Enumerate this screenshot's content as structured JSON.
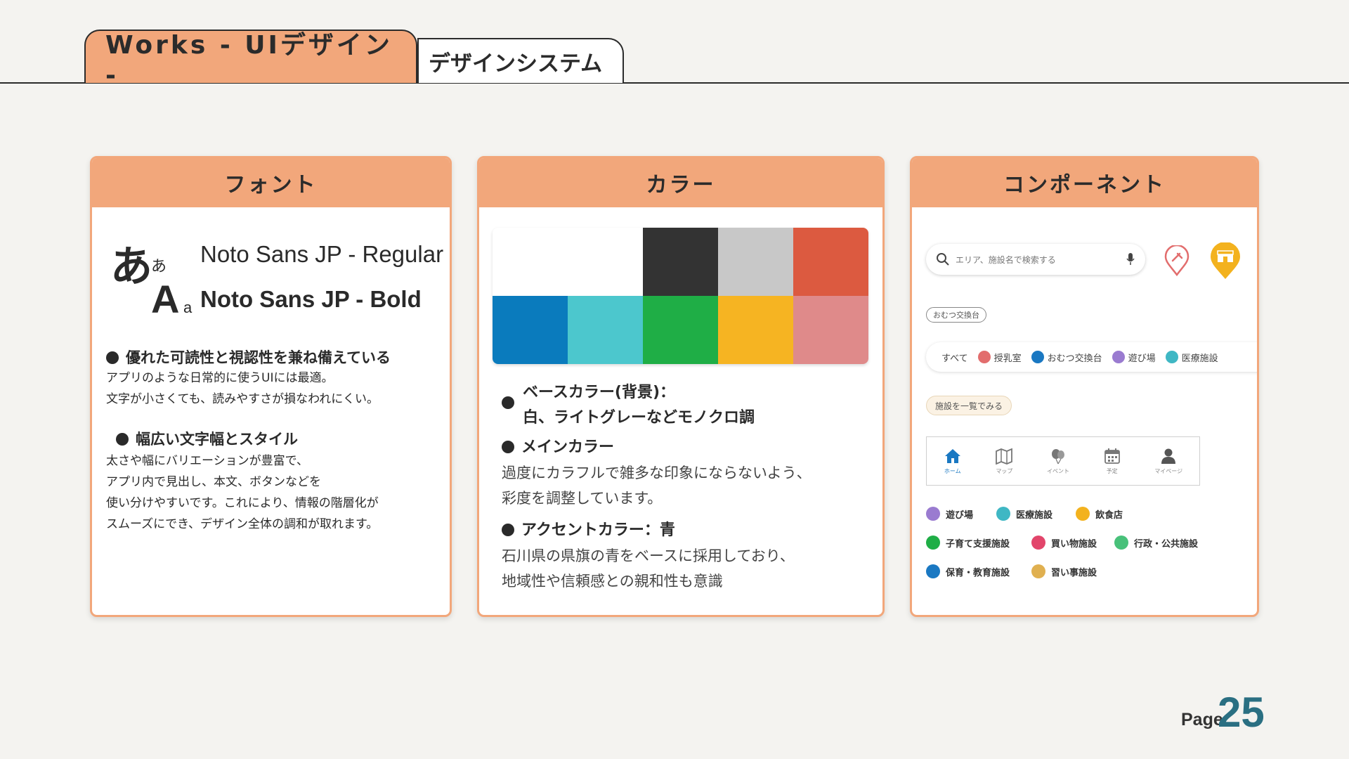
{
  "header": {
    "main_tab": "Works - UIデザイン -",
    "sub_tab": "デザインシステム"
  },
  "font_card": {
    "title": "フォント",
    "glyph_big_hira": "あ",
    "glyph_small_hira": "あ",
    "glyph_big_latin": "A",
    "glyph_small_latin": "a",
    "regular_label": "Noto Sans JP - Regular",
    "bold_label": "Noto Sans JP - Bold",
    "feature1_title": "優れた可読性と視認性を兼ね備えている",
    "feature1_lines": [
      "アプリのような日常的に使うUIには最適。",
      "文字が小さくても、読みやすさが損なわれにくい。"
    ],
    "feature2_title": "幅広い文字幅とスタイル",
    "feature2_lines": [
      "太さや幅にバリエーションが豊富で、",
      "アプリ内で見出し、本文、ボタンなどを",
      "使い分けやすいです。これにより、情報の階層化が",
      "スムーズにでき、デザイン全体の調和が取れます。"
    ]
  },
  "color_card": {
    "title": "カラー",
    "swatches": [
      "#ffffff",
      "#ffffff",
      "#333333",
      "#c8c8c8",
      "#dc5a40",
      "#0a7bbd",
      "#4cc7cd",
      "#1fae46",
      "#f6b422",
      "#df8a8a"
    ],
    "base_title_1": "ベースカラー(背景)：",
    "base_title_2": "白、ライトグレーなどモノクロ調",
    "main_title": "メインカラー",
    "main_lines": [
      "過度にカラフルで雑多な印象にならないよう、",
      "彩度を調整しています。"
    ],
    "accent_title": "アクセントカラー：青",
    "accent_lines": [
      "石川県の県旗の青をベースに採用しており、",
      "地域性や信頼感との親和性も意識"
    ]
  },
  "component_card": {
    "title": "コンポーネント",
    "search_placeholder": "エリア、施設名で検索する",
    "chip_label": "おむつ交換台",
    "filters": [
      {
        "label": "すべて",
        "color": ""
      },
      {
        "label": "授乳室",
        "color": "#e26d6d"
      },
      {
        "label": "おむつ交換台",
        "color": "#1a78c2"
      },
      {
        "label": "遊び場",
        "color": "#9a7bd0"
      },
      {
        "label": "医療施設",
        "color": "#3fb7c4"
      }
    ],
    "list_button": "施設を一覧でみる",
    "nav": [
      {
        "label": "ホーム",
        "icon": "home-icon"
      },
      {
        "label": "マップ",
        "icon": "map-icon"
      },
      {
        "label": "イベント",
        "icon": "balloon-icon"
      },
      {
        "label": "予定",
        "icon": "calendar-icon"
      },
      {
        "label": "マイページ",
        "icon": "person-icon"
      }
    ],
    "categories": [
      {
        "label": "遊び場",
        "color": "#9a7bd0"
      },
      {
        "label": "医療施設",
        "color": "#3fb7c4"
      },
      {
        "label": "飲食店",
        "color": "#f3b21e"
      },
      {
        "label": "子育て支援施設",
        "color": "#1fae46"
      },
      {
        "label": "買い物施設",
        "color": "#e2456b"
      },
      {
        "label": "行政・公共施設",
        "color": "#48c17a"
      },
      {
        "label": "保育・教育施設",
        "color": "#1a78c2"
      },
      {
        "label": "習い事施設",
        "color": "#e0b050"
      }
    ]
  },
  "page": {
    "word": "Page",
    "number": "25"
  }
}
